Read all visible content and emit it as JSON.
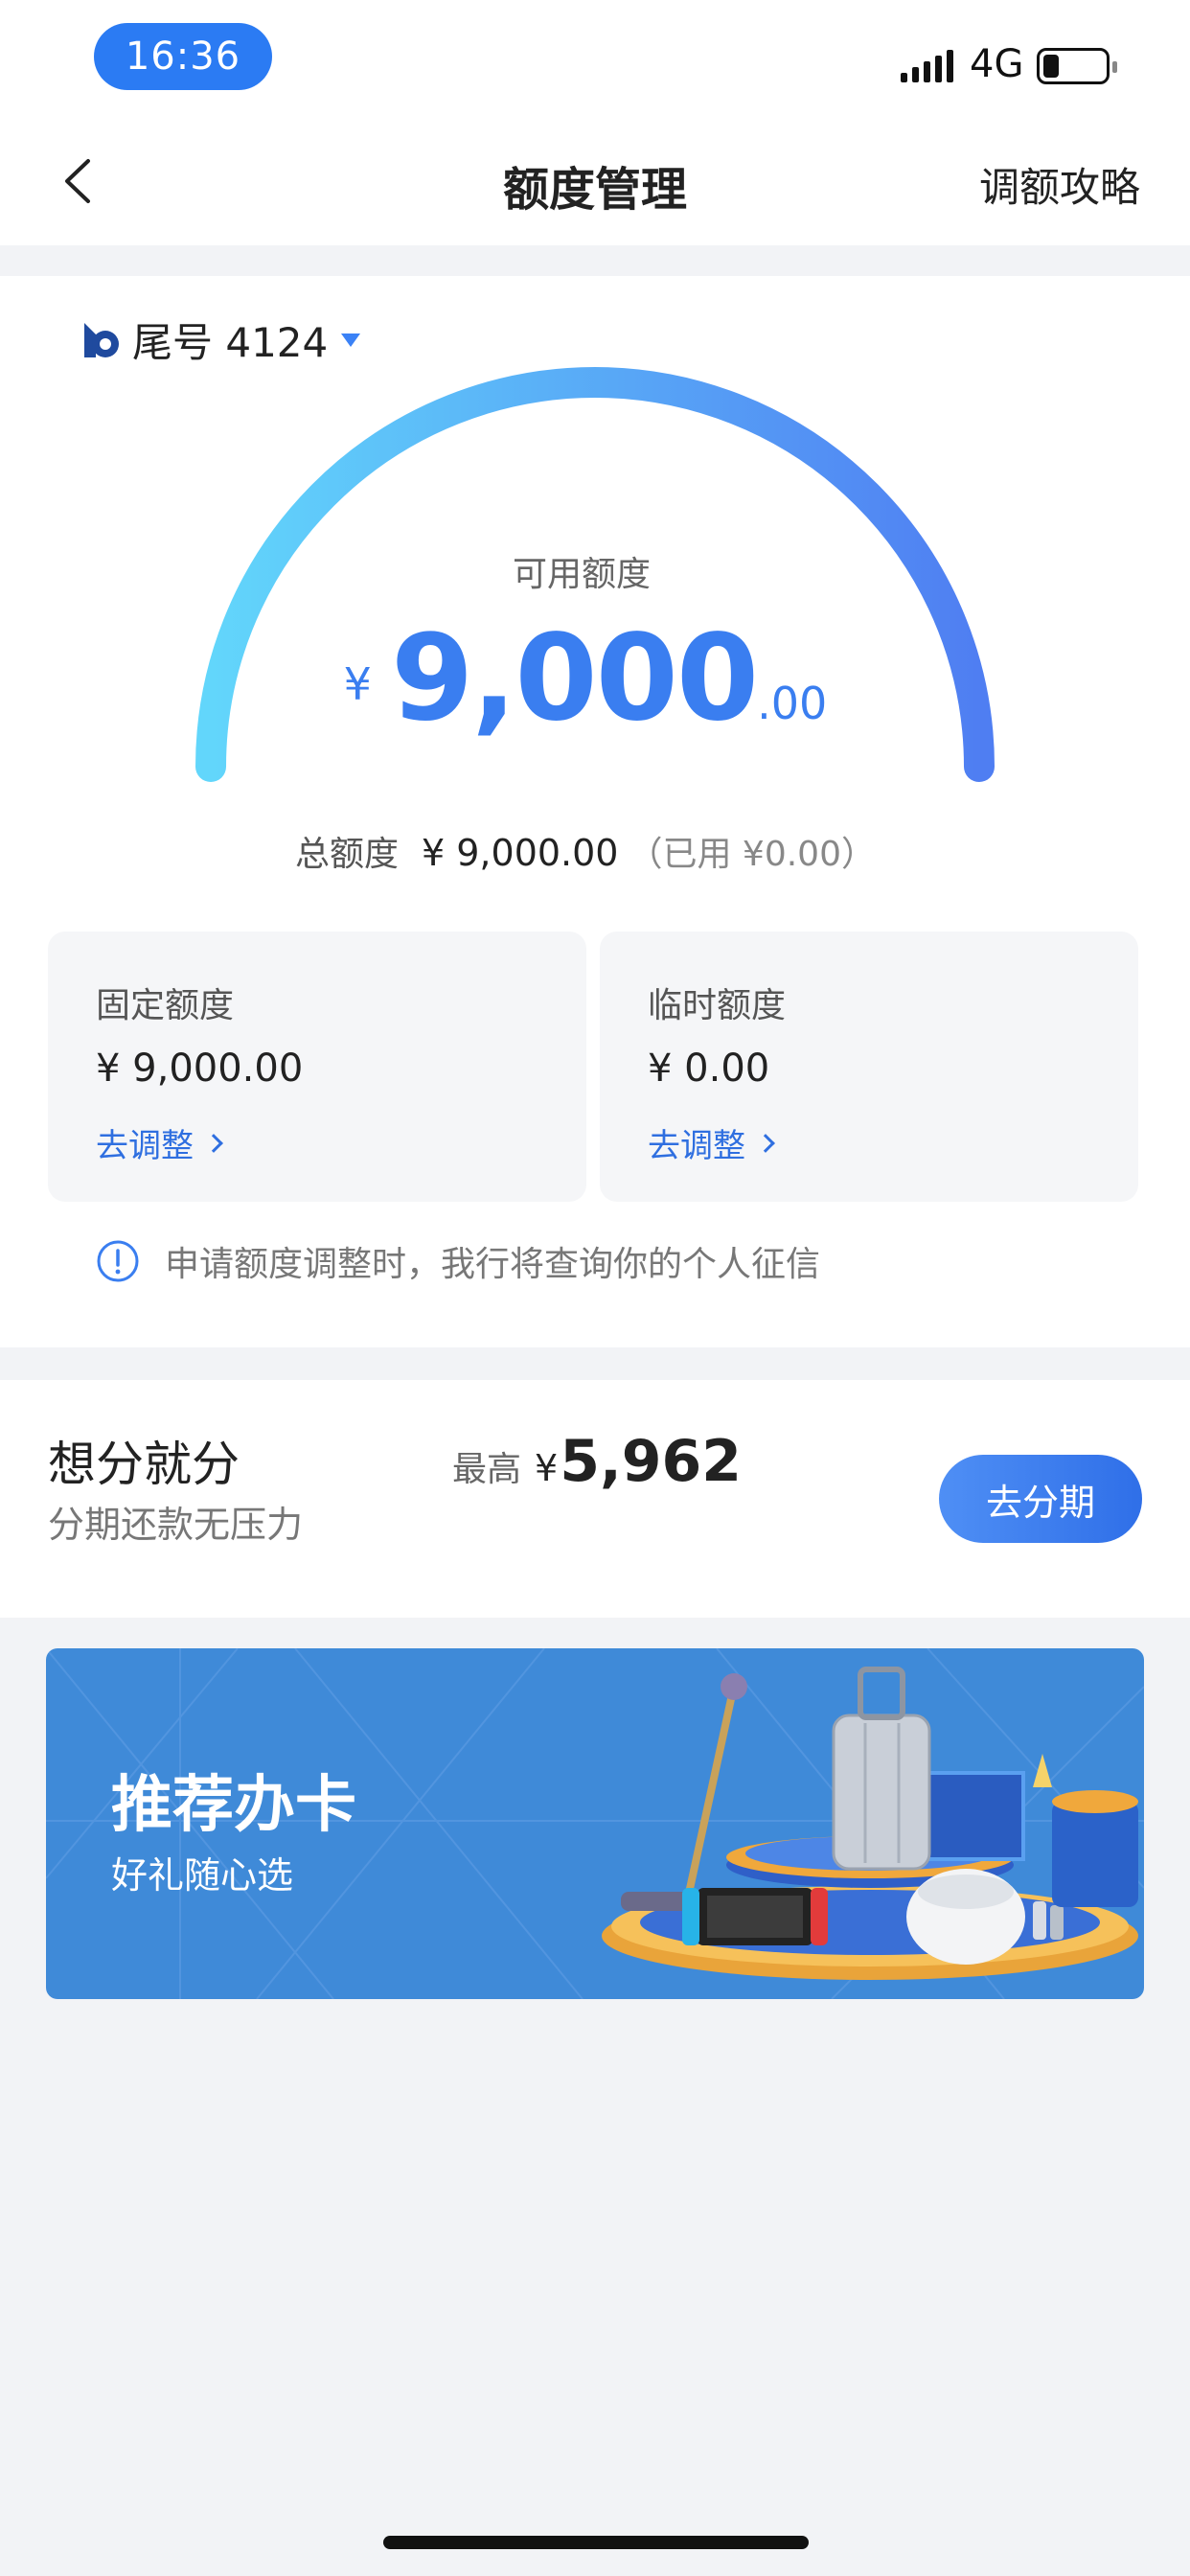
{
  "status_bar": {
    "time": "16:36",
    "network": "4G"
  },
  "nav": {
    "title": "额度管理",
    "right_link": "调额攻略"
  },
  "card": {
    "selector_label": "尾号 4124"
  },
  "gauge": {
    "label": "可用额度",
    "currency": "¥",
    "amount_integer": "9,000",
    "amount_decimal": ".00",
    "fill_fraction": 1.0
  },
  "total": {
    "label": "总额度",
    "value": "¥ 9,000.00",
    "used": "（已用 ¥0.00）"
  },
  "fixed": {
    "title": "固定额度",
    "value": "¥ 9,000.00",
    "link": "去调整"
  },
  "temp": {
    "title": "临时额度",
    "value": "¥ 0.00",
    "link": "去调整"
  },
  "notice": {
    "text": "申请额度调整时，我行将查询你的个人征信"
  },
  "installment": {
    "title": "想分就分",
    "subtitle": "分期还款无压力",
    "max_label": "最高",
    "currency": "¥",
    "max_value": "5,962",
    "button": "去分期"
  },
  "banner": {
    "title": "推荐办卡",
    "subtitle": "好礼随心选"
  },
  "colors": {
    "accent": "#3a7ef0",
    "gauge_start": "#62d6fb",
    "gauge_end": "#4f7ef2"
  }
}
